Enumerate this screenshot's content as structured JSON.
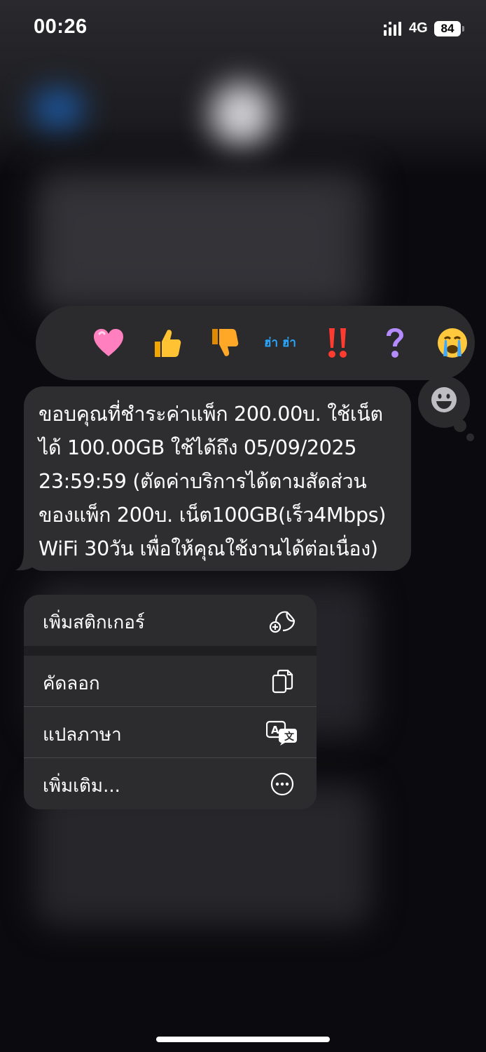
{
  "status_bar": {
    "time": "00:26",
    "network": "4G",
    "battery": "84"
  },
  "reactions": [
    "heart",
    "thumbs-up",
    "thumbs-down",
    "ฮ่า ฮ่า",
    "!!",
    "?",
    "crying"
  ],
  "message": {
    "text": "ขอบคุณที่ชำระค่าแพ็ก 200.00บ. ใช้เน็ต\nได้ 100.00GB ใช้ได้ถึง 05/09/2025\n23:59:59 (ตัดค่าบริการได้ตามสัดส่วน\nของแพ็ก 200บ. เน็ต100GB(เร็ว4Mbps)\nWiFi 30วัน เพื่อให้คุณใช้งานได้ต่อเนื่อง)"
  },
  "menu": {
    "add_sticker": "เพิ่มสติกเกอร์",
    "copy": "คัดลอก",
    "translate": "แปลภาษา",
    "more": "เพิ่มเติม..."
  },
  "colors": {
    "bubble": "#2e2e31",
    "menu": "#2c2c2e",
    "background": "#0b0b0f"
  }
}
